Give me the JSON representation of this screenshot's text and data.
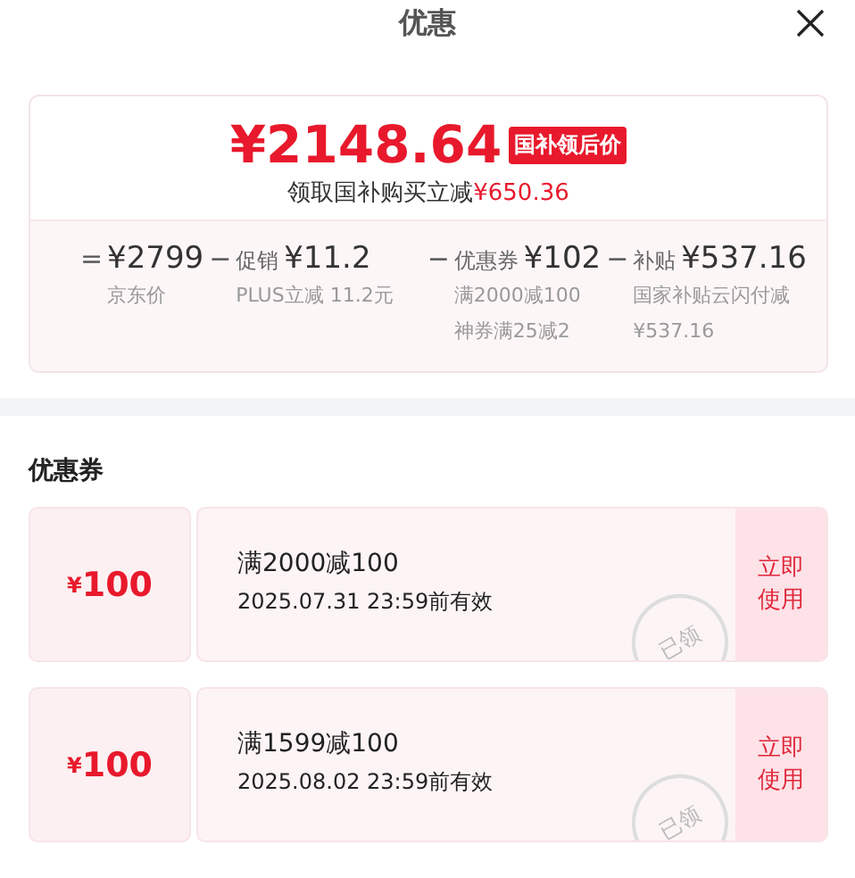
{
  "header": {
    "title": "优惠"
  },
  "price_card": {
    "amount": "¥2148.64",
    "badge": "国补领后价",
    "summary": "领取国补购买立减",
    "saving": "¥650.36",
    "breakdown": [
      {
        "operator": "=",
        "value": "¥2799",
        "notes": [
          "京东价"
        ]
      },
      {
        "operator": "−",
        "label": "促销",
        "value": "¥11.2",
        "notes": [
          "PLUS立减 11.2元"
        ]
      },
      {
        "operator": "−",
        "label": "优惠券",
        "value": "¥102",
        "notes": [
          "满2000减100",
          "神券满25减2"
        ]
      },
      {
        "operator": "−",
        "label": "补贴",
        "value": "¥537.16",
        "notes": [
          "国家补贴云闪付减",
          "¥537.16"
        ]
      }
    ]
  },
  "coupons_section": {
    "heading": "优惠券",
    "coupons": [
      {
        "currency": "¥",
        "value": "100",
        "title": "满2000减100",
        "expiry": "2025.07.31 23:59前有效",
        "stamp": "已领",
        "claimed": true,
        "button": "立即使用"
      },
      {
        "currency": "¥",
        "value": "100",
        "title": "满1599减100",
        "expiry": "2025.08.02 23:59前有效",
        "stamp": "已领",
        "claimed": true,
        "button": "立即使用"
      }
    ]
  }
}
